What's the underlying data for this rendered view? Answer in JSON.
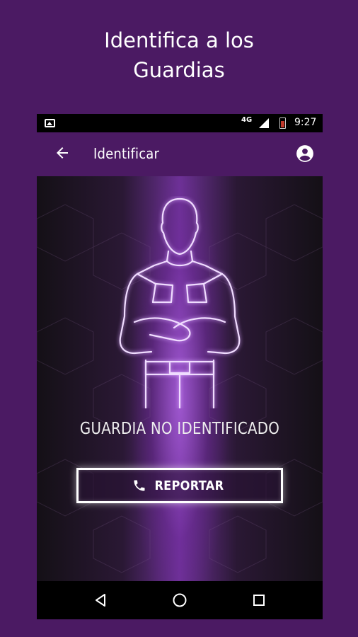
{
  "promo": {
    "title_line1": "Identifica a los",
    "title_line2": "Guardias"
  },
  "status_bar": {
    "network": "4G",
    "time": "9:27"
  },
  "app_bar": {
    "title": "Identificar",
    "back_icon": "arrow-left-icon",
    "account_icon": "account-circle-icon"
  },
  "content": {
    "status_text": "GUARDIA NO IDENTIFICADO",
    "report_button_label": "REPORTAR",
    "report_icon": "phone-icon"
  },
  "nav_bar": {
    "back_icon": "triangle-back-icon",
    "home_icon": "circle-home-icon",
    "recents_icon": "square-recents-icon"
  },
  "colors": {
    "background": "#4b1a63",
    "app_bar": "#4b1a63",
    "glow": "#c878ff"
  }
}
